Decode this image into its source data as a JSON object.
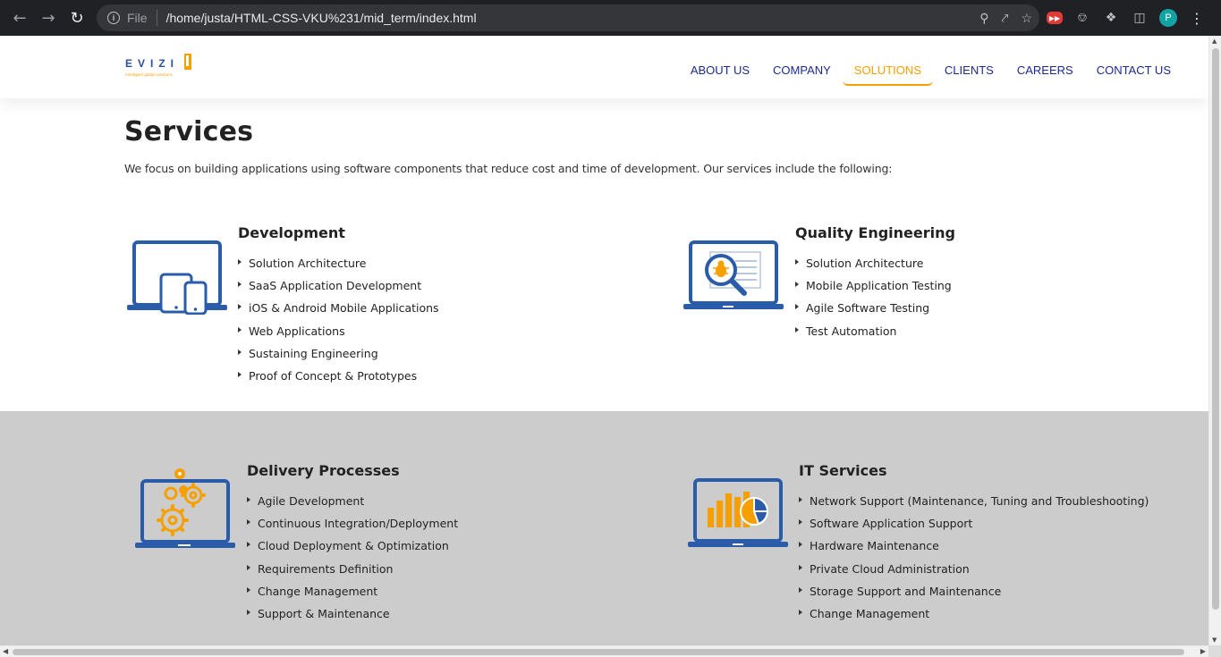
{
  "browser": {
    "scheme": "File",
    "url": "/home/justa/HTML-CSS-VKU%231/mid_term/index.html",
    "profile_initial": "P"
  },
  "site": {
    "logo_text": "EVIZI",
    "logo_tagline": "intelligent global solutions",
    "nav": [
      {
        "label": "ABOUT US"
      },
      {
        "label": "COMPANY"
      },
      {
        "label": "SOLUTIONS",
        "active": true
      },
      {
        "label": "CLIENTS"
      },
      {
        "label": "CAREERS"
      },
      {
        "label": "CONTACT US"
      }
    ]
  },
  "main": {
    "title": "Services",
    "intro": "We focus on building applications using software components that reduce cost and time of development. Our services include the following:",
    "services": [
      {
        "title": "Development",
        "icon": "laptop-devices-icon",
        "items": [
          "Solution Architecture",
          "SaaS Application Development",
          "iOS & Android Mobile Applications",
          "Web Applications",
          "Sustaining Engineering",
          "Proof of Concept & Prototypes"
        ]
      },
      {
        "title": "Quality Engineering",
        "icon": "laptop-bug-search-icon",
        "items": [
          "Solution Architecture",
          "Mobile Application Testing",
          "Agile Software Testing",
          "Test Automation"
        ]
      },
      {
        "title": "Delivery Processes",
        "icon": "laptop-gears-icon",
        "items": [
          "Agile Development",
          "Continuous Integration/Deployment",
          "Cloud Deployment & Optimization",
          "Requirements Definition",
          "Change Management",
          "Support & Maintenance"
        ]
      },
      {
        "title": "IT Services",
        "icon": "laptop-chart-icon",
        "items": [
          "Network Support (Maintenance, Tuning and Troubleshooting)",
          "Software Application Support",
          "Hardware Maintenance",
          "Private Cloud Administration",
          "Storage Support and Maintenance",
          "Change Management"
        ]
      }
    ]
  },
  "colors": {
    "brand_blue": "#2a5caa",
    "accent_orange": "#f5a000",
    "nav_blue": "#1b2a8f",
    "band_grey": "#cccccc"
  }
}
